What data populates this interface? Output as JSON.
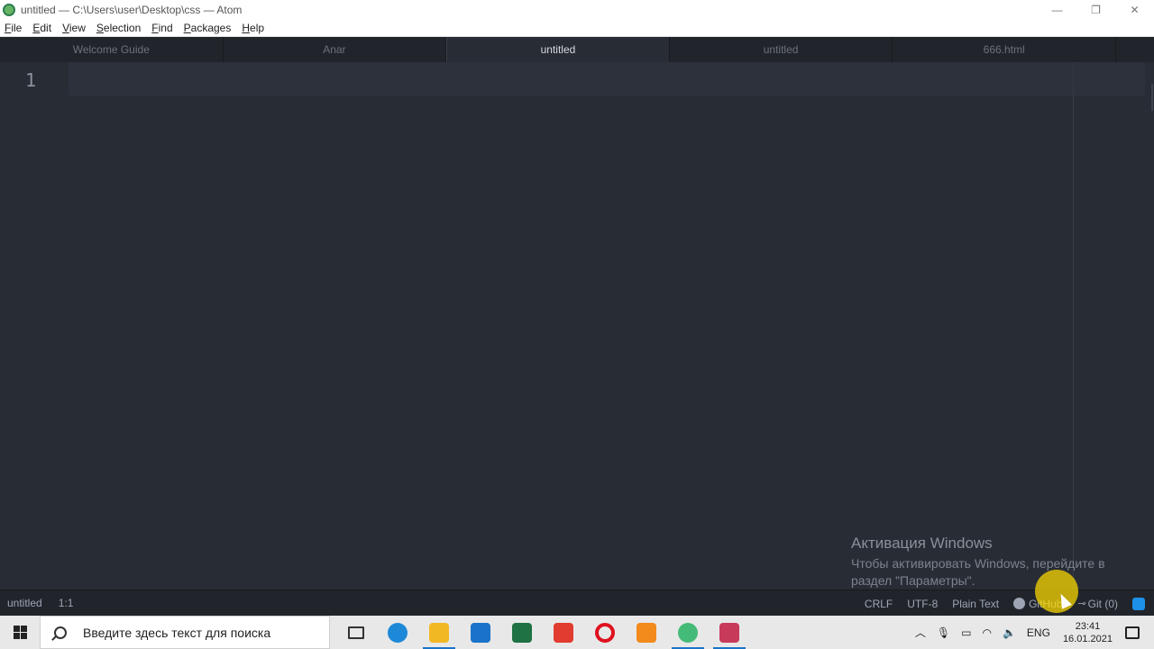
{
  "window": {
    "title": "untitled — C:\\Users\\user\\Desktop\\css — Atom",
    "minimize": "—",
    "restore": "❐",
    "close": "✕"
  },
  "menu": [
    {
      "mn": "F",
      "rest": "ile"
    },
    {
      "mn": "E",
      "rest": "dit"
    },
    {
      "mn": "V",
      "rest": "iew"
    },
    {
      "mn": "S",
      "rest": "election"
    },
    {
      "mn": "F",
      "rest": "ind"
    },
    {
      "mn": "P",
      "rest": "ackages"
    },
    {
      "mn": "H",
      "rest": "elp"
    }
  ],
  "tabs": [
    {
      "label": "Welcome Guide"
    },
    {
      "label": "Anar"
    },
    {
      "label": "untitled"
    },
    {
      "label": "untitled"
    },
    {
      "label": "666.html"
    }
  ],
  "editor": {
    "line_number": "1"
  },
  "watermark": {
    "title": "Активация Windows",
    "subtitle": "Чтобы активировать Windows, перейдите в раздел \"Параметры\"."
  },
  "status": {
    "file": "untitled",
    "position": "1:1",
    "line_ending": "CRLF",
    "encoding": "UTF-8",
    "grammar": "Plain Text",
    "github": "GitHub",
    "git": "Git (0)"
  },
  "taskbar": {
    "search_placeholder": "Введите здесь текст для поиска",
    "apps": [
      {
        "icon": "task-view-icon",
        "color": "#333333"
      },
      {
        "icon": "edge-icon",
        "color": "#1e88d8"
      },
      {
        "icon": "file-explorer-icon",
        "color": "#f2b824"
      },
      {
        "icon": "mail-icon",
        "color": "#1a73c8"
      },
      {
        "icon": "excel-icon",
        "color": "#1f7244"
      },
      {
        "icon": "yandex-browser-icon",
        "color": "#e23b2f"
      },
      {
        "icon": "opera-icon",
        "color": "#e0111f"
      },
      {
        "icon": "sublime-text-icon",
        "color": "#f28a1c"
      },
      {
        "icon": "atom-icon",
        "color": "#44bb77"
      },
      {
        "icon": "paint-icon",
        "color": "#c83a5a"
      }
    ],
    "language": "ENG",
    "time": "23:41",
    "date": "16.01.2021"
  }
}
